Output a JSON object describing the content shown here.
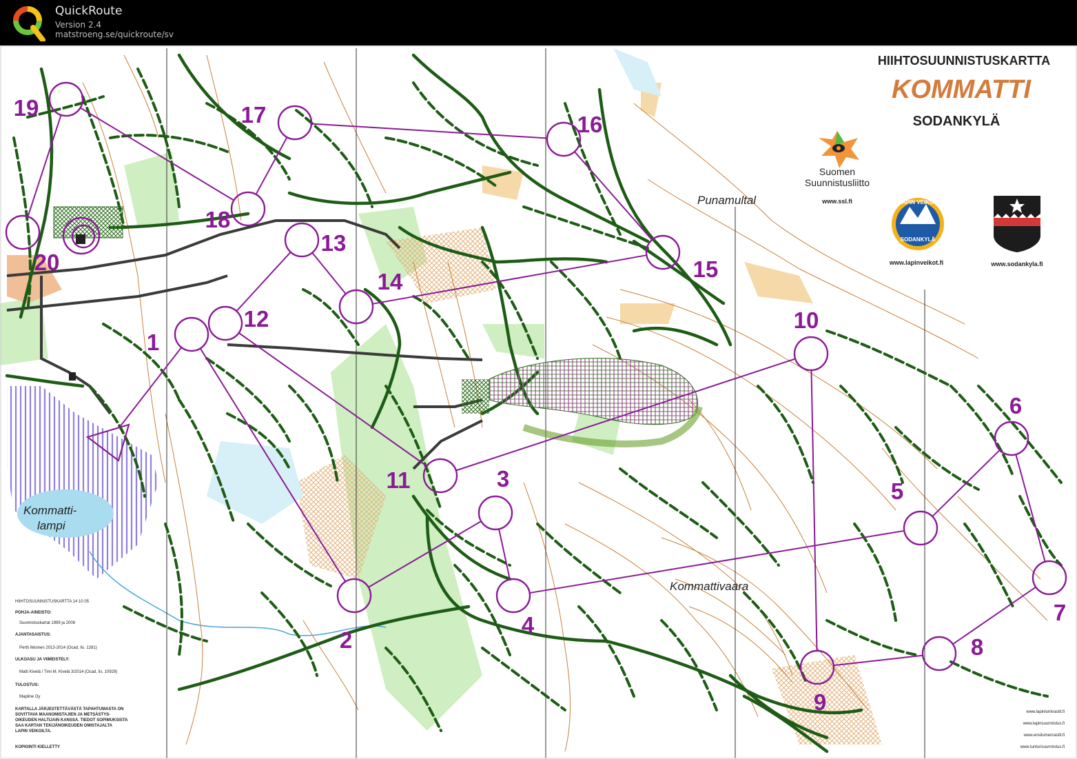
{
  "app": {
    "title": "QuickRoute",
    "version": "Version 2.4",
    "url": "matstroeng.se/quickroute/sv"
  },
  "map": {
    "header_title": "HIIHTOSUUNNISTUSKARTTA",
    "area_name": "KOMMATTI",
    "municipality": "SODANKYLÄ",
    "place_labels": {
      "punamultal": "Punamultal",
      "kommattivaara": "Kommattivaara",
      "lake_line1": "Kommatti-",
      "lake_line2": "lampi"
    },
    "sponsors": {
      "ssl_line1": "Suomen",
      "ssl_line2": "Suunnistusliitto",
      "ssl_url": "www.ssl.fi",
      "lapinveikot_url": "www.lapinveikot.fi",
      "lapinveikot_badge_top": "LAPIN VEIKOT",
      "lapinveikot_badge_bottom": "SODANKYLÄ",
      "sodankyla_url": "www.sodankyla.fi"
    },
    "credits": [
      {
        "text": "HIIHTOSUUNNISTUSKARTTA 14 10 05",
        "bold": false
      },
      {
        "text": "POHJA-AINEISTO:",
        "bold": true
      },
      {
        "text": "Suunnistuskartat 1999 ja 2008",
        "bold": false
      },
      {
        "text": "AJANTASAISTUS:",
        "bold": true
      },
      {
        "text": "Pertti Ikkonen 2013-2014 (Ocad, lis. 1281)",
        "bold": false
      },
      {
        "text": "ULKOASU JA VIIMEISTELY:",
        "bold": true
      },
      {
        "text": "Matti Kivelä / Timi M. Kivelä 3/2014 (Ocad, lis. 10929)",
        "bold": false
      },
      {
        "text": "TULOSTUS:",
        "bold": true
      },
      {
        "text": "Mapline Oy",
        "bold": false
      },
      {
        "text": "KARTALLA JÄRJESTETTÄVÄSTÄ TAPAHTUMASTA ON",
        "bold": true
      },
      {
        "text": "SOVITTAVA MAANOMISTAJIEN JA METSÄSTYS-",
        "bold": true
      },
      {
        "text": "OIKEUDEN HALTIJAIN KANSSA. TIEDOT SOPIMUKSISTA",
        "bold": true
      },
      {
        "text": "SAA KARTAN TEKIJÄNOIKEUDEN OMISTAJALTA",
        "bold": true
      },
      {
        "text": "LAPIN VEIKOILTA.",
        "bold": true
      },
      {
        "text": "KOPIOINTI KIELLETTY",
        "bold": true
      }
    ],
    "links": [
      "www.lapinlumirastit.fi",
      "www.lapinsuunnistus.fi",
      "www.ensilumenrastit.fi",
      "www.tunturisuunnistus.fi"
    ],
    "course": {
      "color": "#8a1a96",
      "start": {
        "label": "start-triangle"
      },
      "controls": [
        {
          "num": "1"
        },
        {
          "num": "2"
        },
        {
          "num": "3"
        },
        {
          "num": "4"
        },
        {
          "num": "5"
        },
        {
          "num": "6"
        },
        {
          "num": "7"
        },
        {
          "num": "8"
        },
        {
          "num": "9"
        },
        {
          "num": "10"
        },
        {
          "num": "11"
        },
        {
          "num": "12"
        },
        {
          "num": "13"
        },
        {
          "num": "14"
        },
        {
          "num": "15"
        },
        {
          "num": "16"
        },
        {
          "num": "17"
        },
        {
          "num": "18"
        },
        {
          "num": "19"
        },
        {
          "num": "20"
        }
      ]
    },
    "colors": {
      "track": "#1e5c16",
      "contour": "#c8803a",
      "course": "#8a1a96",
      "green_area": "#cfeec2",
      "yellow_area": "#f6d9a8",
      "water": "#a9dcef",
      "marsh": "#8f7fe0"
    }
  }
}
